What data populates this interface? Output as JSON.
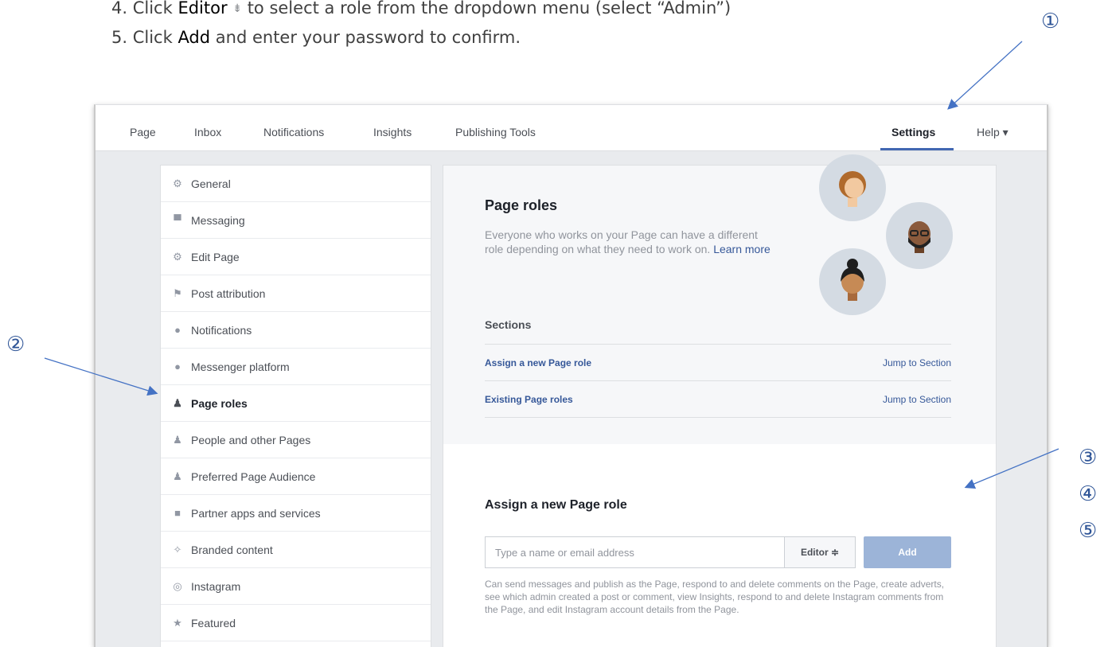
{
  "instructions": {
    "step4": {
      "prefix": "4.  Click ",
      "bold": "Editor",
      "caret": "⇟",
      "suffix": " to select a role from the dropdown menu (select “Admin”)"
    },
    "step5": {
      "prefix": "5.  Click ",
      "bold": "Add",
      "suffix": " and enter your password to confirm."
    }
  },
  "markers": [
    "①",
    "②",
    "③",
    "④",
    "⑤"
  ],
  "topnav": {
    "items": [
      "Page",
      "Inbox",
      "Notifications",
      "Insights",
      "Publishing Tools"
    ],
    "settings": "Settings",
    "help": "Help ▾"
  },
  "sidebar": {
    "items": [
      {
        "label": "General",
        "icon": "gear-icon",
        "glyph": "⚙"
      },
      {
        "label": "Messaging",
        "icon": "messaging-icon",
        "glyph": "▀"
      },
      {
        "label": "Edit Page",
        "icon": "gear-icon",
        "glyph": "⚙"
      },
      {
        "label": "Post attribution",
        "icon": "flag-icon",
        "glyph": "⚑"
      },
      {
        "label": "Notifications",
        "icon": "globe-icon",
        "glyph": "●"
      },
      {
        "label": "Messenger platform",
        "icon": "messenger-icon",
        "glyph": "●"
      },
      {
        "label": "Page roles",
        "icon": "person-icon",
        "glyph": "♟",
        "active": true
      },
      {
        "label": "People and other Pages",
        "icon": "people-icon",
        "glyph": "♟"
      },
      {
        "label": "Preferred Page Audience",
        "icon": "people-icon",
        "glyph": "♟"
      },
      {
        "label": "Partner apps and services",
        "icon": "box-icon",
        "glyph": "■"
      },
      {
        "label": "Branded content",
        "icon": "handshake-icon",
        "glyph": "✧"
      },
      {
        "label": "Instagram",
        "icon": "instagram-icon",
        "glyph": "◎"
      },
      {
        "label": "Featured",
        "icon": "star-icon",
        "glyph": "★"
      }
    ]
  },
  "main": {
    "title": "Page roles",
    "description": "Everyone who works on your Page can have a different role depending on what they need to work on. ",
    "learn_more": "Learn more",
    "sections_title": "Sections",
    "sections": [
      {
        "label": "Assign a new Page role",
        "jump": "Jump to Section"
      },
      {
        "label": "Existing Page roles",
        "jump": "Jump to Section"
      }
    ],
    "assign_title": "Assign a new Page role",
    "input_placeholder": "Type a name or email address",
    "role_select": "Editor ≑",
    "add_label": "Add",
    "role_description": "Can send messages and publish as the Page, respond to and delete comments on the Page, create adverts, see which admin created a post or comment, view Insights, respond to and delete Instagram comments from the Page, and edit Instagram account details from the Page."
  },
  "colors": {
    "accent": "#4267b2",
    "link": "#365899",
    "annotation": "#2f5597",
    "add_button": "#9cb4d8"
  }
}
